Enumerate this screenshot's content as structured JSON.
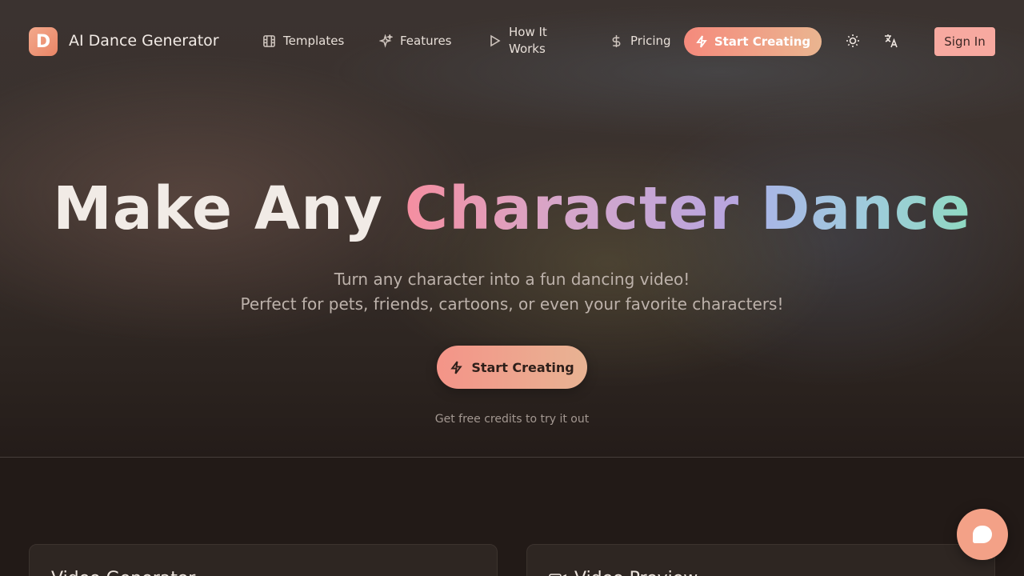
{
  "header": {
    "brand_letter": "D",
    "brand_name": "AI Dance Generator",
    "nav": {
      "templates": "Templates",
      "features": "Features",
      "how_it_works_line1": "How It",
      "how_it_works_line2": "Works",
      "pricing": "Pricing"
    },
    "start_creating": "Start Creating",
    "sign_in": "Sign In"
  },
  "hero": {
    "headline_part1": "Make Any",
    "headline_part2": "Character",
    "headline_part3": "Dance",
    "subtitle_line1": "Turn any character into a fun dancing video!",
    "subtitle_line2": "Perfect for pets, friends, cartoons, or even your favorite characters!",
    "cta_label": "Start Creating",
    "note": "Get free credits to try it out"
  },
  "cards": {
    "left_title": "Video Generator",
    "right_title": "Video Preview"
  },
  "icons": {
    "logo": "logo-icon",
    "templates": "film-icon",
    "features": "sparkles-icon",
    "how_it_works": "play-icon",
    "pricing": "dollar-icon",
    "start": "lightning-icon",
    "theme": "sun-icon",
    "language": "translate-icon",
    "chat": "chat-icon",
    "video": "video-camera-icon"
  },
  "colors": {
    "accent_start": "#f58a7c",
    "accent_end": "#eab590",
    "sign_in_bg": "#f7a9a0",
    "background": "#221a17"
  }
}
